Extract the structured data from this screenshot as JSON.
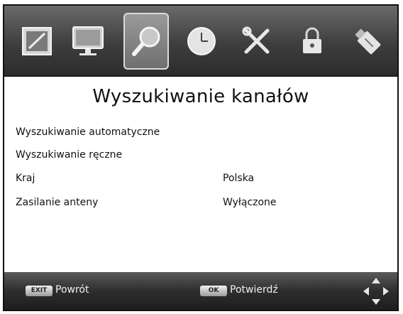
{
  "menu": {
    "items": [
      {
        "name": "picture-icon"
      },
      {
        "name": "monitor-icon"
      },
      {
        "name": "search-icon"
      },
      {
        "name": "clock-icon"
      },
      {
        "name": "tools-icon"
      },
      {
        "name": "lock-icon"
      },
      {
        "name": "usb-icon"
      }
    ],
    "active_index": 2
  },
  "screen": {
    "title": "Wyszukiwanie kanałów",
    "rows": [
      {
        "label": "Wyszukiwanie automatyczne",
        "value": ""
      },
      {
        "label": "Wyszukiwanie ręczne",
        "value": ""
      },
      {
        "label": "Kraj",
        "value": "Polska"
      },
      {
        "label": "Zasilanie anteny",
        "value": "Wyłączone"
      }
    ]
  },
  "footer": {
    "exit_key": "EXIT",
    "exit_label": "Powrót",
    "ok_key": "OK",
    "ok_label": "Potwierdź"
  }
}
